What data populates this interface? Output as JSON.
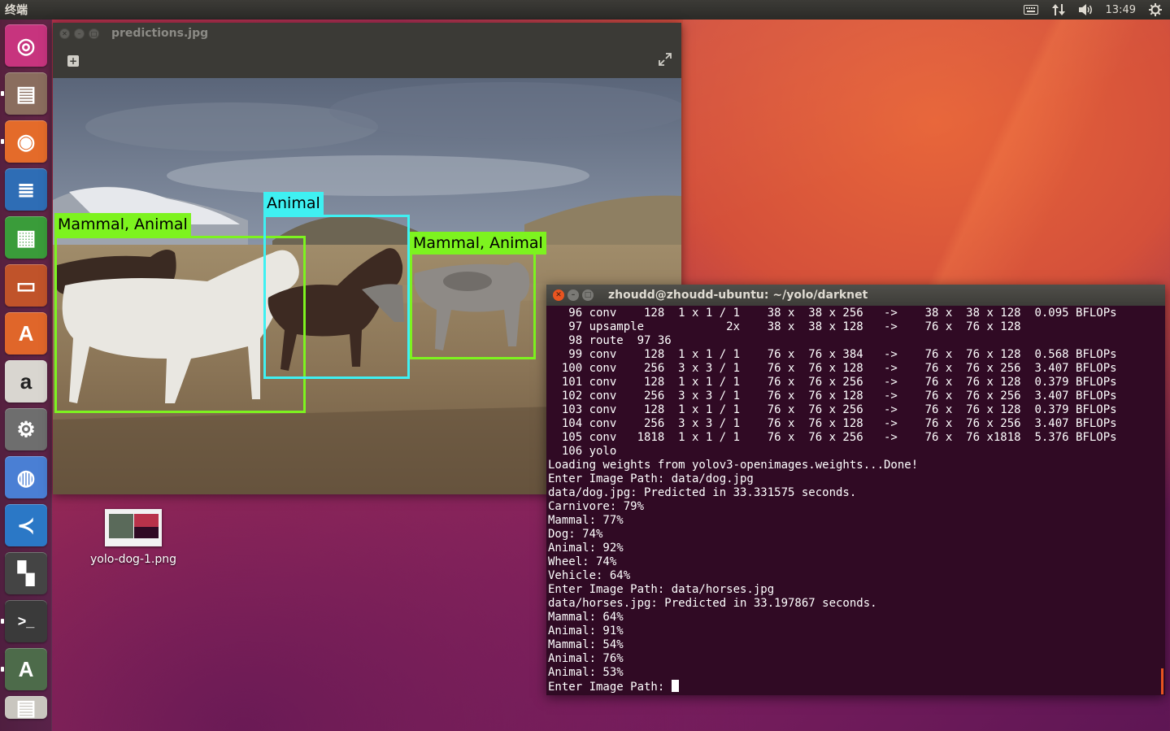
{
  "top_panel": {
    "app_title": "终端",
    "clock": "13:49",
    "indicators": [
      "keyboard-icon",
      "network-icon",
      "volume-icon",
      "power-gear-icon"
    ]
  },
  "launcher": {
    "items": [
      {
        "name": "ubuntu-dash",
        "icon": "ubuntu-logo-icon",
        "color": "#c7347e"
      },
      {
        "name": "files",
        "icon": "file-cabinet-icon",
        "color": "#8a6d5e"
      },
      {
        "name": "firefox",
        "icon": "firefox-icon",
        "color": "#e46b2a"
      },
      {
        "name": "libreoffice-writer",
        "icon": "writer-doc-icon",
        "color": "#2e6db5"
      },
      {
        "name": "libreoffice-calc",
        "icon": "calc-sheet-icon",
        "color": "#3a9c3a"
      },
      {
        "name": "libreoffice-impress",
        "icon": "impress-slide-icon",
        "color": "#c0532a"
      },
      {
        "name": "ubuntu-software",
        "icon": "software-bag-icon",
        "color": "#e0662a"
      },
      {
        "name": "amazon",
        "icon": "amazon-icon",
        "color": "#d9d6d0"
      },
      {
        "name": "system-settings",
        "icon": "settings-wrench-icon",
        "color": "#6e6e6e"
      },
      {
        "name": "chromium",
        "icon": "chromium-icon",
        "color": "#4a7fd4"
      },
      {
        "name": "vscode",
        "icon": "vscode-icon",
        "color": "#2b78c6"
      },
      {
        "name": "office-suite",
        "icon": "four-squares-icon",
        "color": "#444444"
      },
      {
        "name": "terminal",
        "icon": "terminal-icon",
        "color": "#3a3a3a"
      },
      {
        "name": "software-updater",
        "icon": "updater-icon",
        "color": "#4d6b4a"
      },
      {
        "name": "document-viewer",
        "icon": "documents-stack-icon",
        "color": "#c9c6bf"
      }
    ]
  },
  "viewer": {
    "title": "predictions.jpg",
    "detections": [
      {
        "label": "Mammal,  Animal",
        "color": "#7df31f"
      },
      {
        "label": "Animal",
        "color": "#3ff0f2"
      },
      {
        "label": "Mammal,  Animal",
        "color": "#7df31f"
      }
    ]
  },
  "desktop": {
    "icon_label": "yolo-dog-1.png"
  },
  "terminal": {
    "title": "zhoudd@zhoudd-ubuntu: ~/yolo/darknet",
    "lines": [
      "   96 conv    128  1 x 1 / 1    38 x  38 x 256   ->    38 x  38 x 128  0.095 BFLOPs",
      "   97 upsample            2x    38 x  38 x 128   ->    76 x  76 x 128",
      "   98 route  97 36",
      "   99 conv    128  1 x 1 / 1    76 x  76 x 384   ->    76 x  76 x 128  0.568 BFLOPs",
      "  100 conv    256  3 x 3 / 1    76 x  76 x 128   ->    76 x  76 x 256  3.407 BFLOPs",
      "  101 conv    128  1 x 1 / 1    76 x  76 x 256   ->    76 x  76 x 128  0.379 BFLOPs",
      "  102 conv    256  3 x 3 / 1    76 x  76 x 128   ->    76 x  76 x 256  3.407 BFLOPs",
      "  103 conv    128  1 x 1 / 1    76 x  76 x 256   ->    76 x  76 x 128  0.379 BFLOPs",
      "  104 conv    256  3 x 3 / 1    76 x  76 x 128   ->    76 x  76 x 256  3.407 BFLOPs",
      "  105 conv   1818  1 x 1 / 1    76 x  76 x 256   ->    76 x  76 x1818  5.376 BFLOPs",
      "  106 yolo",
      "Loading weights from yolov3-openimages.weights...Done!",
      "Enter Image Path: data/dog.jpg",
      "data/dog.jpg: Predicted in 33.331575 seconds.",
      "Carnivore: 79%",
      "Mammal: 77%",
      "Dog: 74%",
      "Animal: 92%",
      "Wheel: 74%",
      "Vehicle: 64%",
      "Enter Image Path: data/horses.jpg",
      "data/horses.jpg: Predicted in 33.197867 seconds.",
      "Mammal: 64%",
      "Animal: 91%",
      "Mammal: 54%",
      "Animal: 76%",
      "Animal: 53%"
    ],
    "prompt": "Enter Image Path: "
  }
}
